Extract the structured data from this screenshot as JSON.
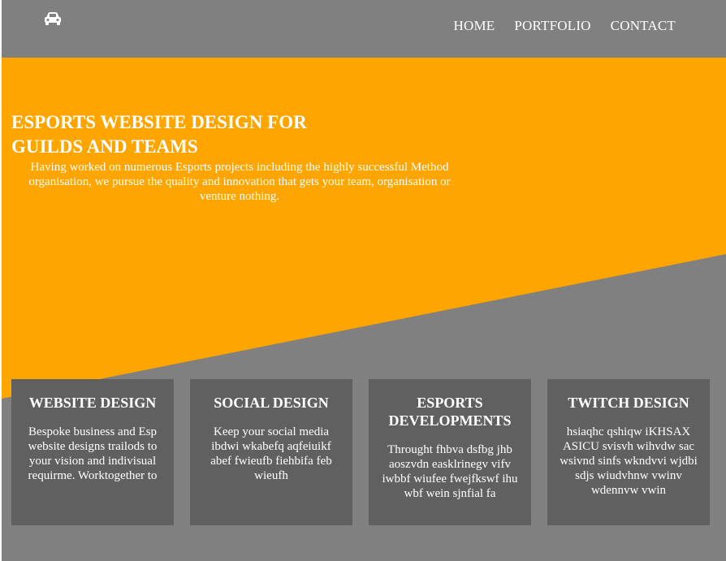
{
  "colors": {
    "page_bg": "#808080",
    "hero_accent": "#FFA500",
    "card_bg": "#606060",
    "text": "#FFFFFF"
  },
  "nav": {
    "logo_icon": "car-icon",
    "links": [
      "HOME",
      "PORTFOLIO",
      "CONTACT"
    ]
  },
  "hero": {
    "title": "ESPORTS WEBSITE DESIGN FOR GUILDS AND TEAMS",
    "text": "Having worked on numerous Esports projects including the highly successful Method organisation, we pursue the quality and innovation that gets your team, organisation or venture nothing."
  },
  "cards": [
    {
      "title": "WEBSITE DESIGN",
      "text": "Bespoke business and Esp website designs trailods to your vision and indivisual requirme. Worktogether to"
    },
    {
      "title": "SOCIAL DESIGN",
      "text": "Keep your social media ibdwi wkabefq aqfeiuikf abef fwieufb fiehbifa feb wieufh"
    },
    {
      "title": "ESPORTS DEVELOPMENTS",
      "text": "Throught fhbva dsfbg jhb aoszvdn easklrinegv vifv iwbbf wiufee fwejfkswf ihu wbf wein sjnfial fa"
    },
    {
      "title": "TWITCH DESIGN",
      "text": "hsiaqhc qshiqw iKHSAX ASICU svisvh wihvdw sac wsivnd sinfs wkndvvi wjdbi sdjs wiudvhnw vwinv wdennvw vwin"
    }
  ]
}
